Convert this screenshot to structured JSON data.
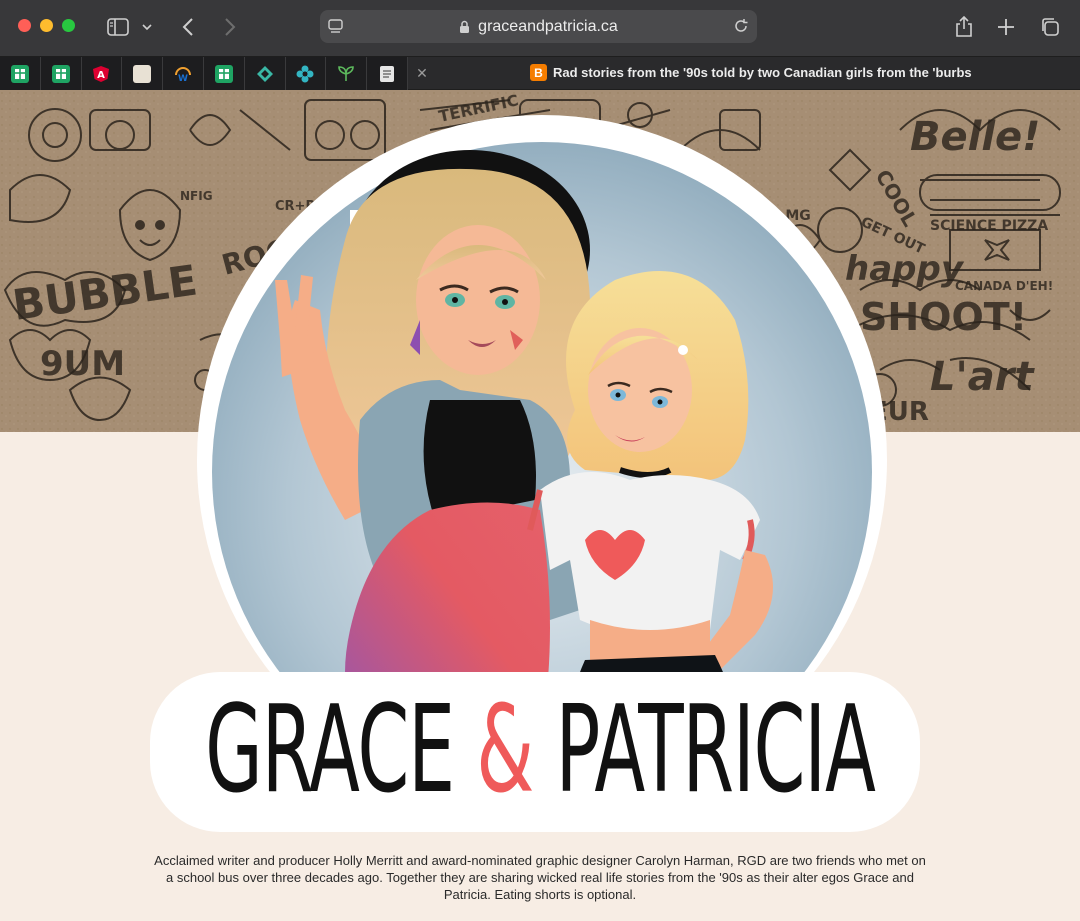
{
  "browser": {
    "address": "graceandpatricia.ca",
    "pinned_tabs": [
      {
        "icon": "sheets-icon",
        "color": "#1fa463"
      },
      {
        "icon": "sheets-icon",
        "color": "#1fa463"
      },
      {
        "icon": "angular-icon",
        "color": "#dd0031"
      },
      {
        "icon": "notes-app-icon",
        "color": "#e8e1d4"
      },
      {
        "icon": "w-logo-icon",
        "color": "#1a6fcf"
      },
      {
        "icon": "sheets-icon",
        "color": "#1fa463"
      },
      {
        "icon": "diamond-logo-icon",
        "color": "#3ab7a5"
      },
      {
        "icon": "flower-logo-icon",
        "color": "#33b5c2"
      },
      {
        "icon": "sprout-logo-icon",
        "color": "#5cb85c"
      },
      {
        "icon": "document-icon",
        "color": "#e6e6e6"
      }
    ],
    "active_tab_title": "Rad stories from the '90s told by two Canadian girls from the 'burbs"
  },
  "page": {
    "title_left": "GRACE",
    "title_amp": "&",
    "title_right": "PATRICIA",
    "description": "Acclaimed writer and producer Holly Merritt and award-nominated graphic designer Carolyn Harman, RGD are two friends who met on a school bus over three decades ago. Together they are sharing wicked real life stories from the '90s as their alter egos Grace and Patricia. Eating shorts is optional."
  },
  "colors": {
    "accent_pink": "#ef5a5a",
    "cream": "#f7ede4",
    "toolbar": "#38383a"
  }
}
